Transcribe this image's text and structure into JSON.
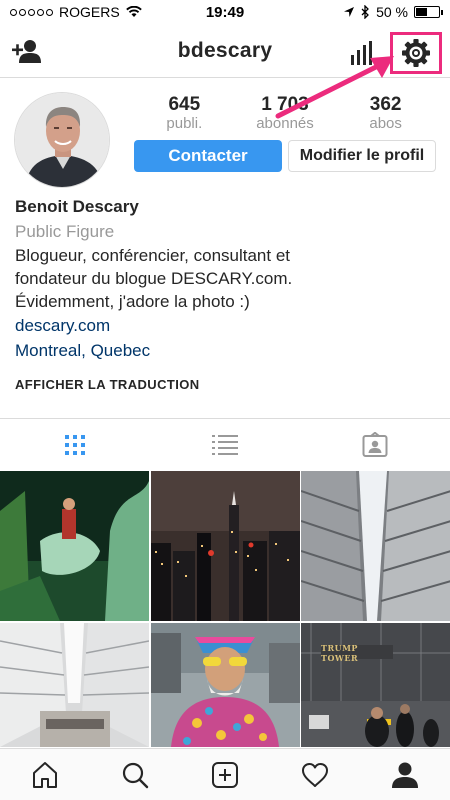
{
  "status_bar": {
    "carrier": "ROGERS",
    "time": "19:49",
    "battery": "50 %",
    "battery_level": 0.5
  },
  "nav": {
    "username": "bdescary"
  },
  "profile": {
    "stats": [
      {
        "value": "645",
        "label": "publi."
      },
      {
        "value": "1 703",
        "label": "abonnés"
      },
      {
        "value": "362",
        "label": "abos"
      }
    ],
    "contact_label": "Contacter",
    "edit_label": "Modifier le profil"
  },
  "bio": {
    "name": "Benoit Descary",
    "category": "Public Figure",
    "lines": [
      "Blogueur, conférencier, consultant et",
      "fondateur du blogue DESCARY.com.",
      "Évidemment, j'adore la photo :)"
    ],
    "link": "descary.com",
    "location": "Montreal, Quebec",
    "translate": "AFFICHER LA TRADUCTION"
  },
  "grid_photos": [
    {
      "name": "photo-ice-sculpture-horse",
      "sign_text": ""
    },
    {
      "name": "photo-city-night-skyline",
      "sign_text": ""
    },
    {
      "name": "photo-oculus-ribs",
      "sign_text": ""
    },
    {
      "name": "photo-oculus-interior",
      "sign_text": ""
    },
    {
      "name": "photo-street-performer",
      "sign_text": ""
    },
    {
      "name": "photo-trump-tower",
      "sign_text": "TRUMP TOWER"
    }
  ],
  "colors": {
    "accent": "#3897f0",
    "highlight": "#ec2b7d",
    "link": "#003569",
    "muted": "#999999",
    "border": "#dbdbdb"
  }
}
